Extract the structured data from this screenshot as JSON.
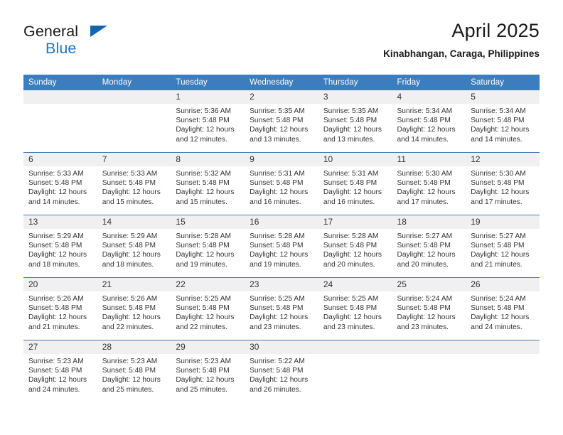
{
  "logo": {
    "word_one": "General",
    "word_two": "Blue",
    "triangle_color": "#1266b0",
    "blue_color": "#1878c8"
  },
  "header": {
    "title": "April 2025",
    "subtitle": "Kinabhangan, Caraga, Philippines"
  },
  "theme": {
    "header_blue": "#3b7dbf",
    "daynum_gray": "#f0f0f0",
    "text_color": "#333333"
  },
  "weekday_headers": [
    "Sunday",
    "Monday",
    "Tuesday",
    "Wednesday",
    "Thursday",
    "Friday",
    "Saturday"
  ],
  "weeks": [
    [
      {
        "day": "",
        "lines": []
      },
      {
        "day": "",
        "lines": []
      },
      {
        "day": "1",
        "lines": [
          "Sunrise: 5:36 AM",
          "Sunset: 5:48 PM",
          "Daylight: 12 hours",
          "and 12 minutes."
        ]
      },
      {
        "day": "2",
        "lines": [
          "Sunrise: 5:35 AM",
          "Sunset: 5:48 PM",
          "Daylight: 12 hours",
          "and 13 minutes."
        ]
      },
      {
        "day": "3",
        "lines": [
          "Sunrise: 5:35 AM",
          "Sunset: 5:48 PM",
          "Daylight: 12 hours",
          "and 13 minutes."
        ]
      },
      {
        "day": "4",
        "lines": [
          "Sunrise: 5:34 AM",
          "Sunset: 5:48 PM",
          "Daylight: 12 hours",
          "and 14 minutes."
        ]
      },
      {
        "day": "5",
        "lines": [
          "Sunrise: 5:34 AM",
          "Sunset: 5:48 PM",
          "Daylight: 12 hours",
          "and 14 minutes."
        ]
      }
    ],
    [
      {
        "day": "6",
        "lines": [
          "Sunrise: 5:33 AM",
          "Sunset: 5:48 PM",
          "Daylight: 12 hours",
          "and 14 minutes."
        ]
      },
      {
        "day": "7",
        "lines": [
          "Sunrise: 5:33 AM",
          "Sunset: 5:48 PM",
          "Daylight: 12 hours",
          "and 15 minutes."
        ]
      },
      {
        "day": "8",
        "lines": [
          "Sunrise: 5:32 AM",
          "Sunset: 5:48 PM",
          "Daylight: 12 hours",
          "and 15 minutes."
        ]
      },
      {
        "day": "9",
        "lines": [
          "Sunrise: 5:31 AM",
          "Sunset: 5:48 PM",
          "Daylight: 12 hours",
          "and 16 minutes."
        ]
      },
      {
        "day": "10",
        "lines": [
          "Sunrise: 5:31 AM",
          "Sunset: 5:48 PM",
          "Daylight: 12 hours",
          "and 16 minutes."
        ]
      },
      {
        "day": "11",
        "lines": [
          "Sunrise: 5:30 AM",
          "Sunset: 5:48 PM",
          "Daylight: 12 hours",
          "and 17 minutes."
        ]
      },
      {
        "day": "12",
        "lines": [
          "Sunrise: 5:30 AM",
          "Sunset: 5:48 PM",
          "Daylight: 12 hours",
          "and 17 minutes."
        ]
      }
    ],
    [
      {
        "day": "13",
        "lines": [
          "Sunrise: 5:29 AM",
          "Sunset: 5:48 PM",
          "Daylight: 12 hours",
          "and 18 minutes."
        ]
      },
      {
        "day": "14",
        "lines": [
          "Sunrise: 5:29 AM",
          "Sunset: 5:48 PM",
          "Daylight: 12 hours",
          "and 18 minutes."
        ]
      },
      {
        "day": "15",
        "lines": [
          "Sunrise: 5:28 AM",
          "Sunset: 5:48 PM",
          "Daylight: 12 hours",
          "and 19 minutes."
        ]
      },
      {
        "day": "16",
        "lines": [
          "Sunrise: 5:28 AM",
          "Sunset: 5:48 PM",
          "Daylight: 12 hours",
          "and 19 minutes."
        ]
      },
      {
        "day": "17",
        "lines": [
          "Sunrise: 5:28 AM",
          "Sunset: 5:48 PM",
          "Daylight: 12 hours",
          "and 20 minutes."
        ]
      },
      {
        "day": "18",
        "lines": [
          "Sunrise: 5:27 AM",
          "Sunset: 5:48 PM",
          "Daylight: 12 hours",
          "and 20 minutes."
        ]
      },
      {
        "day": "19",
        "lines": [
          "Sunrise: 5:27 AM",
          "Sunset: 5:48 PM",
          "Daylight: 12 hours",
          "and 21 minutes."
        ]
      }
    ],
    [
      {
        "day": "20",
        "lines": [
          "Sunrise: 5:26 AM",
          "Sunset: 5:48 PM",
          "Daylight: 12 hours",
          "and 21 minutes."
        ]
      },
      {
        "day": "21",
        "lines": [
          "Sunrise: 5:26 AM",
          "Sunset: 5:48 PM",
          "Daylight: 12 hours",
          "and 22 minutes."
        ]
      },
      {
        "day": "22",
        "lines": [
          "Sunrise: 5:25 AM",
          "Sunset: 5:48 PM",
          "Daylight: 12 hours",
          "and 22 minutes."
        ]
      },
      {
        "day": "23",
        "lines": [
          "Sunrise: 5:25 AM",
          "Sunset: 5:48 PM",
          "Daylight: 12 hours",
          "and 23 minutes."
        ]
      },
      {
        "day": "24",
        "lines": [
          "Sunrise: 5:25 AM",
          "Sunset: 5:48 PM",
          "Daylight: 12 hours",
          "and 23 minutes."
        ]
      },
      {
        "day": "25",
        "lines": [
          "Sunrise: 5:24 AM",
          "Sunset: 5:48 PM",
          "Daylight: 12 hours",
          "and 23 minutes."
        ]
      },
      {
        "day": "26",
        "lines": [
          "Sunrise: 5:24 AM",
          "Sunset: 5:48 PM",
          "Daylight: 12 hours",
          "and 24 minutes."
        ]
      }
    ],
    [
      {
        "day": "27",
        "lines": [
          "Sunrise: 5:23 AM",
          "Sunset: 5:48 PM",
          "Daylight: 12 hours",
          "and 24 minutes."
        ]
      },
      {
        "day": "28",
        "lines": [
          "Sunrise: 5:23 AM",
          "Sunset: 5:48 PM",
          "Daylight: 12 hours",
          "and 25 minutes."
        ]
      },
      {
        "day": "29",
        "lines": [
          "Sunrise: 5:23 AM",
          "Sunset: 5:48 PM",
          "Daylight: 12 hours",
          "and 25 minutes."
        ]
      },
      {
        "day": "30",
        "lines": [
          "Sunrise: 5:22 AM",
          "Sunset: 5:48 PM",
          "Daylight: 12 hours",
          "and 26 minutes."
        ]
      },
      {
        "day": "",
        "lines": []
      },
      {
        "day": "",
        "lines": []
      },
      {
        "day": "",
        "lines": []
      }
    ]
  ]
}
